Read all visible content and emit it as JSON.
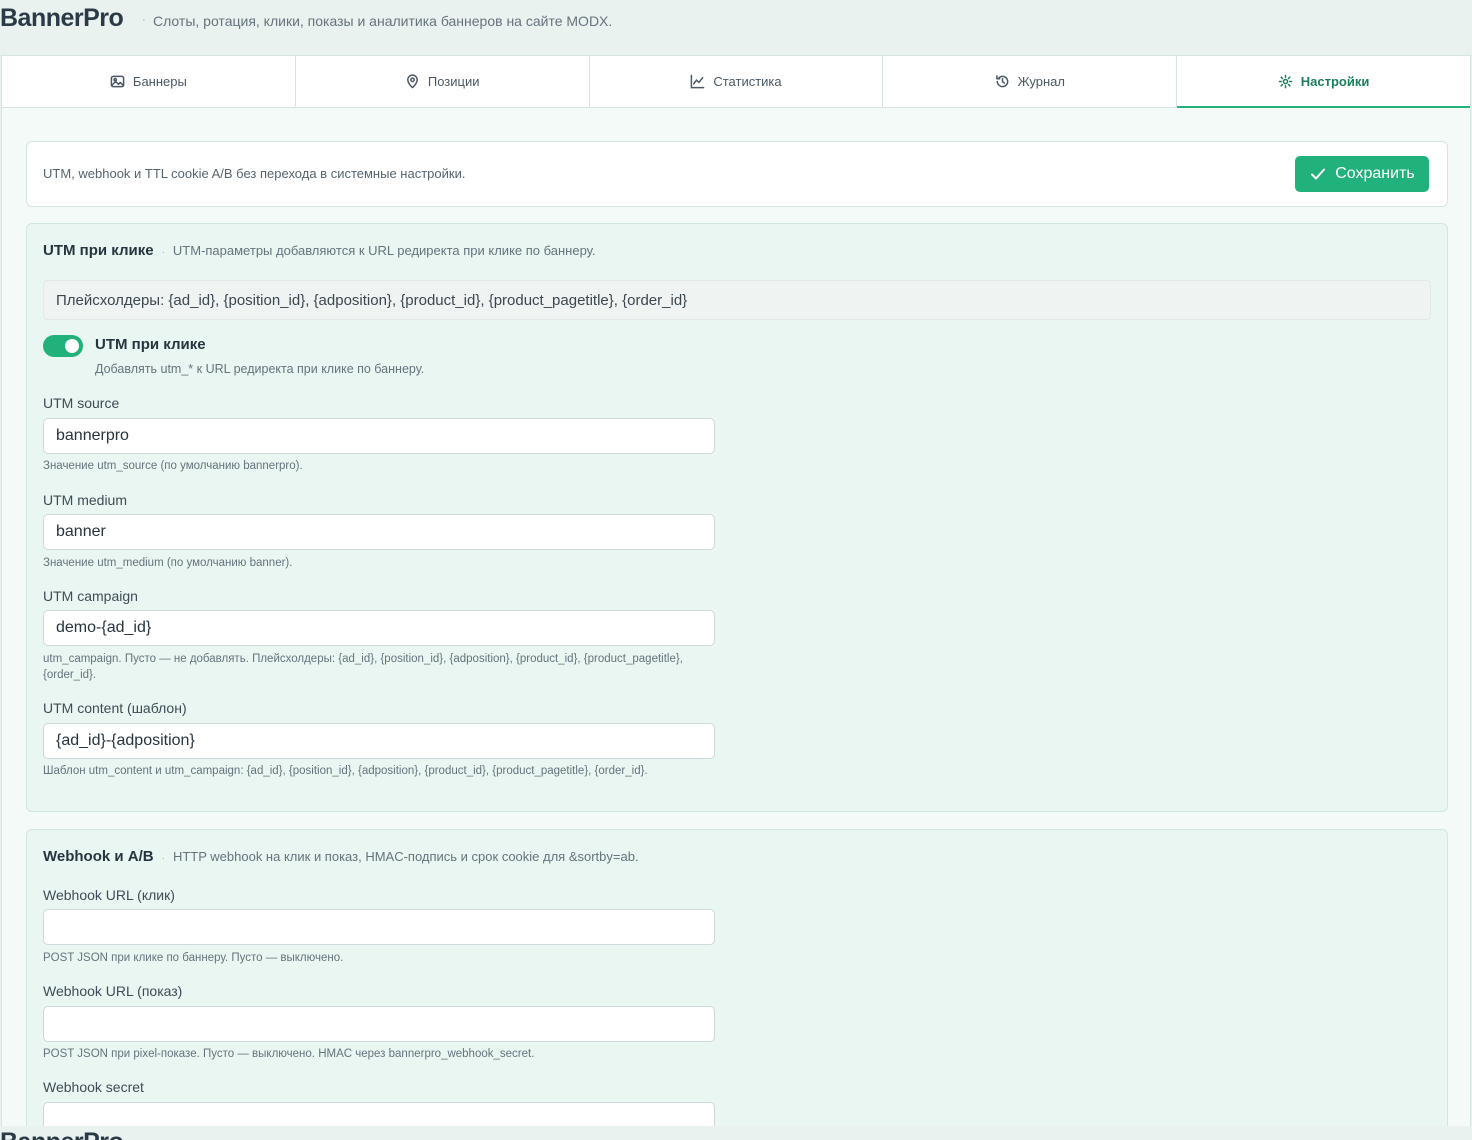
{
  "header": {
    "brand": "BannerPro",
    "separator": "·",
    "description": "Слоты, ротация, клики, показы и аналитика баннеров на сайте MODX."
  },
  "tabs": [
    {
      "label": "Баннеры",
      "icon": "image-icon"
    },
    {
      "label": "Позиции",
      "icon": "map-pin-icon"
    },
    {
      "label": "Статистика",
      "icon": "chart-line-icon"
    },
    {
      "label": "Журнал",
      "icon": "history-icon"
    },
    {
      "label": "Настройки",
      "icon": "gear-icon",
      "active": true
    }
  ],
  "topbar": {
    "text": "UTM, webhook и TTL cookie A/B без перехода в системные настройки.",
    "save_label": "Сохранить"
  },
  "utm_section": {
    "title": "UTM при клике",
    "separator": "·",
    "description": "UTM-параметры добавляются к URL редиректа при клике по баннеру.",
    "placeholders": "Плейсхолдеры: {ad_id}, {position_id}, {adposition}, {product_id}, {product_pagetitle}, {order_id}",
    "toggle": {
      "label": "UTM при клике",
      "help": "Добавлять utm_* к URL редиректа при клике по баннеру.",
      "checked": true
    },
    "fields": [
      {
        "label": "UTM source",
        "value": "bannerpro",
        "help": "Значение utm_source (по умолчанию bannerpro)."
      },
      {
        "label": "UTM medium",
        "value": "banner",
        "help": "Значение utm_medium (по умолчанию banner)."
      },
      {
        "label": "UTM campaign",
        "value": "demo-{ad_id}",
        "help": "utm_campaign. Пусто — не добавлять. Плейсхолдеры: {ad_id}, {position_id}, {adposition}, {product_id}, {product_pagetitle}, {order_id}."
      },
      {
        "label": "UTM content (шаблон)",
        "value": "{ad_id}-{adposition}",
        "help": "Шаблон utm_content и utm_campaign: {ad_id}, {position_id}, {adposition}, {product_id}, {product_pagetitle}, {order_id}."
      }
    ]
  },
  "webhook_section": {
    "title": "Webhook и A/B",
    "separator": "·",
    "description": "HTTP webhook на клик и показ, HMAC-подпись и срок cookie для &sortby=ab.",
    "fields": [
      {
        "label": "Webhook URL (клик)",
        "value": "",
        "help": "POST JSON при клике по баннеру. Пусто — выключено."
      },
      {
        "label": "Webhook URL (показ)",
        "value": "",
        "help": "POST JSON при pixel-показе. Пусто — выключено. HMAC через bannerpro_webhook_secret."
      },
      {
        "label": "Webhook secret",
        "value": ""
      }
    ]
  },
  "colors": {
    "accent": "#20b27a",
    "active_tab_text": "#1b7f5a",
    "section_bg": "#eaf6f1",
    "page_bg": "#e9f2ee"
  }
}
